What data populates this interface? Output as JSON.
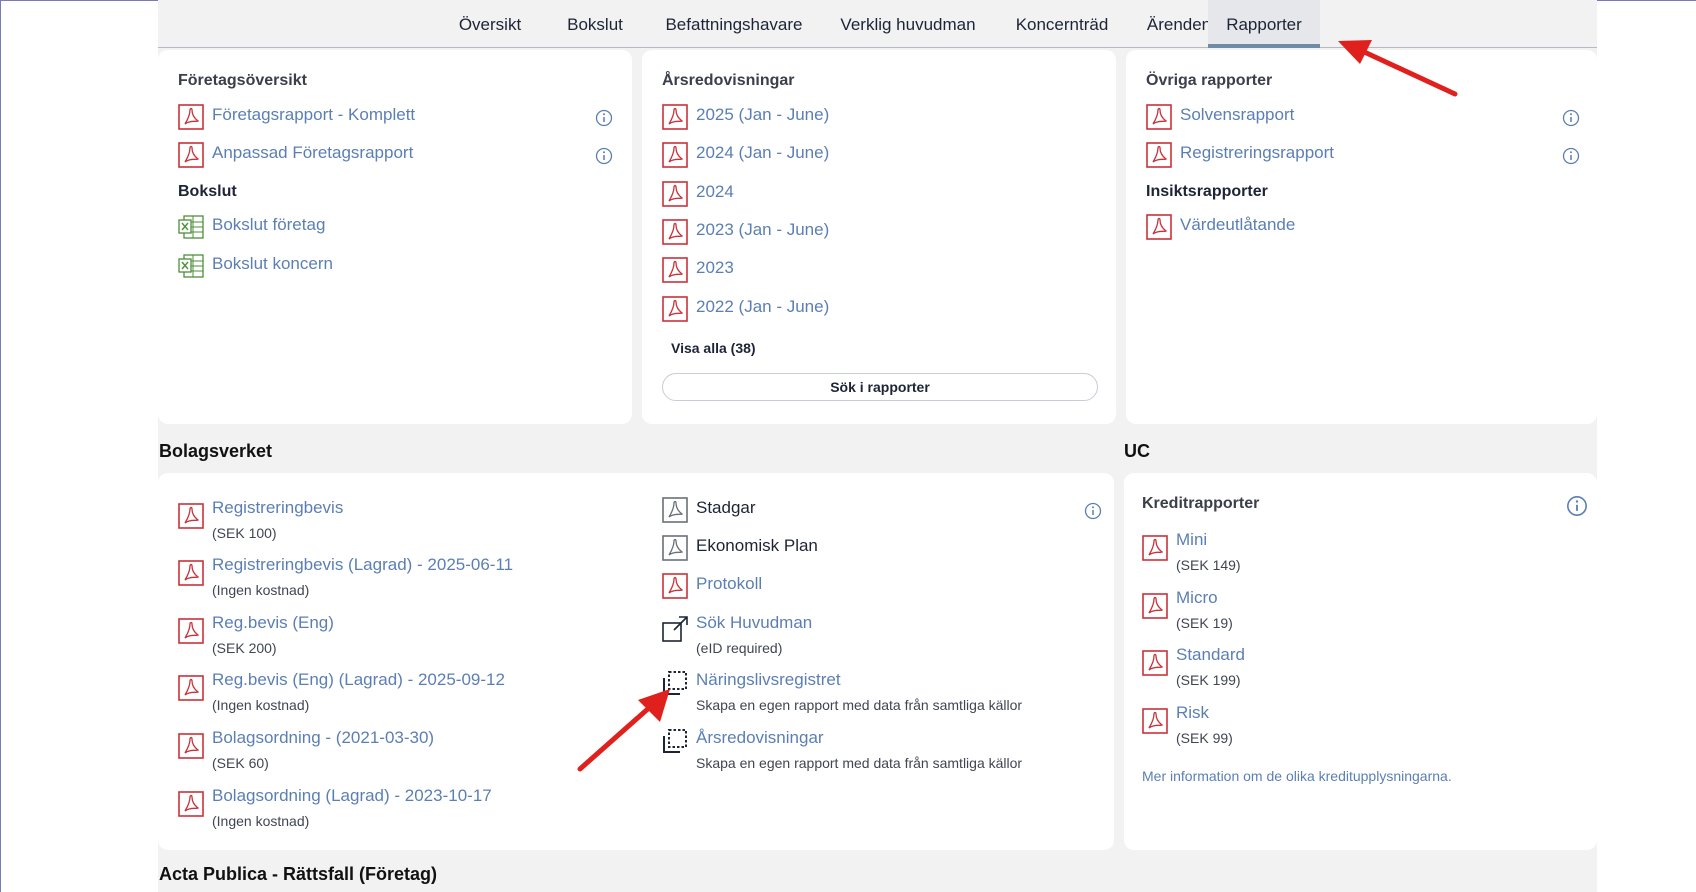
{
  "tabs": [
    "Översikt",
    "Bokslut",
    "Befattningshavare",
    "Verklig huvudman",
    "Koncernträd",
    "Ärenden",
    "Rapporter"
  ],
  "active_tab": "Rapporter",
  "foretag": {
    "heading": "Företagsöversikt",
    "items": [
      "Företagsrapport - Komplett",
      "Anpassad Företagsrapport"
    ],
    "bokslut_heading": "Bokslut",
    "bokslut_items": [
      "Bokslut företag",
      "Bokslut koncern"
    ]
  },
  "arsredovisningar": {
    "heading": "Årsredovisningar",
    "items": [
      "2025 (Jan - June)",
      "2024 (Jan - June)",
      "2024",
      "2023 (Jan - June)",
      "2023",
      "2022 (Jan - June)"
    ],
    "visa_alla": "Visa alla (38)",
    "search_button": "Sök i rapporter"
  },
  "ovriga": {
    "heading": "Övriga rapporter",
    "items": [
      "Solvensrapport",
      "Registreringsrapport"
    ],
    "insikt_heading": "Insiktsrapporter",
    "insikt_items": [
      "Värdeutlåtande"
    ]
  },
  "bolagsverket": {
    "title": "Bolagsverket",
    "left_items": [
      {
        "label": "Registreringbevis",
        "sub": "(SEK 100)"
      },
      {
        "label": "Registreringbevis (Lagrad) - 2025-06-11",
        "sub": "(Ingen kostnad)"
      },
      {
        "label": "Reg.bevis (Eng)",
        "sub": "(SEK 200)"
      },
      {
        "label": "Reg.bevis (Eng) (Lagrad) - 2025-09-12",
        "sub": "(Ingen kostnad)"
      },
      {
        "label": "Bolagsordning - (2021-03-30)",
        "sub": "(SEK 60)"
      },
      {
        "label": "Bolagsordning (Lagrad) - 2023-10-17",
        "sub": "(Ingen kostnad)"
      }
    ],
    "right_items": [
      {
        "label": "Stadgar",
        "sub": ""
      },
      {
        "label": "Ekonomisk Plan",
        "sub": ""
      },
      {
        "label": "Protokoll",
        "sub": ""
      },
      {
        "label": "Sök Huvudman",
        "sub": "(eID required)"
      },
      {
        "label": "Näringslivsregistret",
        "sub": "Skapa en egen rapport med data från samtliga källor"
      },
      {
        "label": "Årsredovisningar",
        "sub": "Skapa en egen rapport med data från samtliga källor"
      }
    ]
  },
  "uc": {
    "title": "UC",
    "heading": "Kreditrapporter",
    "items": [
      {
        "label": "Mini",
        "sub": "(SEK 149)"
      },
      {
        "label": "Micro",
        "sub": "(SEK 19)"
      },
      {
        "label": "Standard",
        "sub": "(SEK 199)"
      },
      {
        "label": "Risk",
        "sub": "(SEK 99)"
      }
    ],
    "more_link": "Mer information om de olika kreditupplysningarna."
  },
  "acta": {
    "title": "Acta Publica - Rättsfall (Företag)"
  },
  "colors": {
    "link": "#5b7fb4",
    "pdf": "#c8323a",
    "excel": "#4e8f3a",
    "accent_tab": "#6f8ca6",
    "arrow": "#e0201c"
  }
}
